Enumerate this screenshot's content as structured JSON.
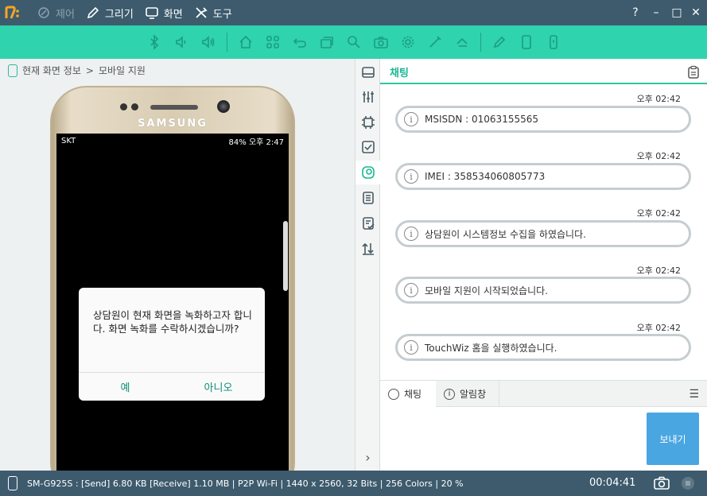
{
  "titlebar": {
    "menus": [
      {
        "label": "제어",
        "icon": "control-icon",
        "enabled": false
      },
      {
        "label": "그리기",
        "icon": "pen-icon",
        "enabled": true
      },
      {
        "label": "화면",
        "icon": "monitor-icon",
        "enabled": true
      },
      {
        "label": "도구",
        "icon": "tools-icon",
        "enabled": true
      }
    ],
    "controls": [
      "?",
      "–",
      "□",
      "✕"
    ]
  },
  "toolbar": {
    "icons": [
      "bluetooth-off-icon",
      "volume-down-icon",
      "volume-up-icon",
      "home-icon",
      "apps-icon",
      "back-icon",
      "recent-apps-icon",
      "search-icon",
      "camera-icon",
      "settings-icon",
      "brush-icon",
      "eraser-icon",
      "pen-edit-icon",
      "phone-portrait-icon",
      "phone-vibrate-icon"
    ]
  },
  "breadcrumb": {
    "root": "현재 화면 정보",
    "separator": ">",
    "current": "모바일 지원"
  },
  "device": {
    "brand": "SAMSUNG",
    "status_left": "SKT",
    "status_right": "84% 오후 2:47",
    "dialog": {
      "message": "상담원이 현재 화면을 녹화하고자 합니다. 화면 녹화를 수락하시겠습니까?",
      "yes": "예",
      "no": "아니오"
    }
  },
  "strip": {
    "icons": [
      "drive-icon",
      "sliders-icon",
      "chip-icon",
      "checkbox-icon",
      "chat-bubble-icon",
      "document-icon",
      "document-check-icon",
      "transfer-icon"
    ],
    "expand": "›"
  },
  "chat": {
    "title": "채팅",
    "messages": [
      {
        "time": "오후 02:42",
        "text": "MSISDN : 01063155565"
      },
      {
        "time": "오후 02:42",
        "text": "IMEI : 358534060805773"
      },
      {
        "time": "오후 02:42",
        "text": "상담원이 시스템정보 수집을 하였습니다."
      },
      {
        "time": "오후 02:42",
        "text": "모바일 지원이 시작되었습니다."
      },
      {
        "time": "오후 02:42",
        "text": "TouchWiz 홈을 실행하였습니다."
      }
    ],
    "tabs": [
      {
        "label": "채팅"
      },
      {
        "label": "알림창"
      }
    ],
    "send": "보내기"
  },
  "statusbar": {
    "info": "SM-G925S : [Send] 6.80 KB  [Receive] 1.10 MB | P2P Wi-Fi | 1440 x 2560, 32 Bits | 256 Colors | 20 %",
    "timer": "00:04:41"
  },
  "colors": {
    "titlebar": "#3d5b6d",
    "toolbar": "#2fd3ad",
    "accent": "#19b892",
    "send": "#4aa6e0"
  }
}
